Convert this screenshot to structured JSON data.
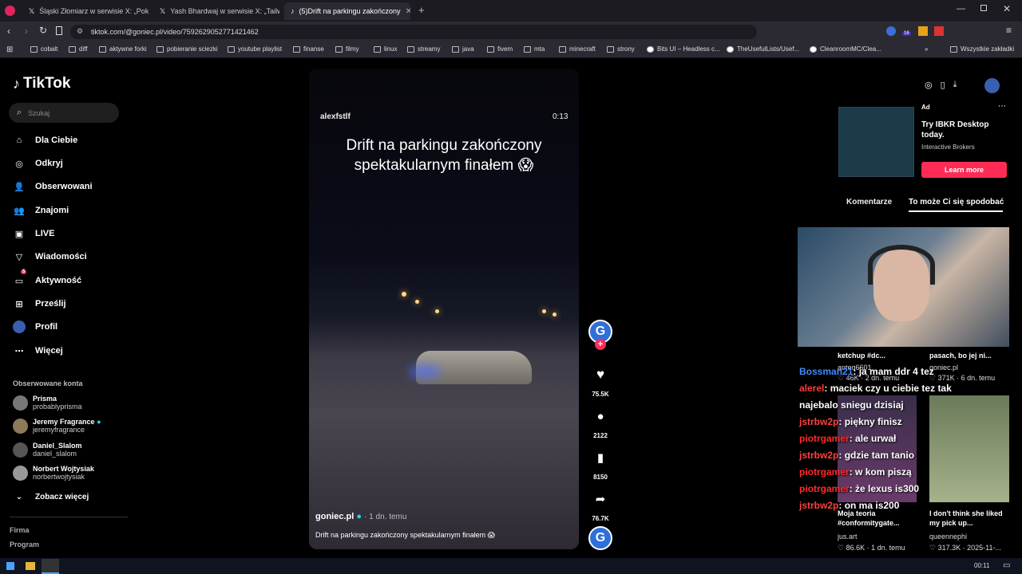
{
  "browser": {
    "tabs": [
      {
        "label": "Śląski Złomiarz w serwisie X: „Pokole"
      },
      {
        "label": "Yash Bhardwaj w serwisie X: „Tailwind"
      },
      {
        "label": "(5)Drift na parkingu zakończony"
      }
    ],
    "url": "tiktok.com/@goniec.pl/video/7592629052771421462",
    "bookmarks": [
      "cobalt",
      "diff",
      "aktywne forki",
      "pobieranie sciezki",
      "youtube playlist",
      "finanse",
      "filmy",
      "linux",
      "streamy",
      "java",
      "fivem",
      "mta",
      "minecraft",
      "strony",
      "Bits UI – Headless c...",
      "TheUsefulLists/Usef...",
      "CleanroomMC/Clea..."
    ],
    "bookmarks_all": "Wszystkie zakładki",
    "ext_badge": "16"
  },
  "sidebar": {
    "logo": "TikTok",
    "search_placeholder": "Szukaj",
    "nav": [
      "Dla Ciebie",
      "Odkryj",
      "Obserwowani",
      "Znajomi",
      "LIVE",
      "Wiadomości",
      "Aktywność",
      "Prześlij",
      "Profil",
      "Więcej"
    ],
    "activity_badge": "5",
    "following_title": "Obserwowane konta",
    "accounts": [
      {
        "name": "Prisma",
        "handle": "probablyprisma"
      },
      {
        "name": "Jeremy Fragrance",
        "handle": "jeremyfragrance"
      },
      {
        "name": "Daniel_Slalom",
        "handle": "daniel_slalom"
      },
      {
        "name": "Norbert Wojtysiak",
        "handle": "norbertwojtysiak"
      }
    ],
    "see_more": "Zobacz więcej",
    "footer": [
      "Firma",
      "Program"
    ]
  },
  "video": {
    "author": "alexfstlf",
    "time": "0:13",
    "overlay_title": "Drift na parkingu zakończony spektakularnym finałem 😱",
    "poster": "goniec.pl",
    "posted": "· 1 dn. temu",
    "caption": "Drift na parkingu zakończony spektakularnym finałem 😱",
    "likes": "75.5K",
    "comments": "2122",
    "saves": "8150",
    "shares": "76.7K"
  },
  "ad": {
    "label": "Ad",
    "title": "Try IBKR Desktop today.",
    "brand": "Interactive Brokers",
    "cta": "Learn more"
  },
  "right_tabs": {
    "comments": "Komentarze",
    "recommended": "To może Ci się spodobać"
  },
  "cards": [
    {
      "title": "ketchup #dc...",
      "user": "anteq6601",
      "likes": "46K",
      "when": "2 dn. temu"
    },
    {
      "title": "pasach, bo jej ni...",
      "user": "goniec.pl",
      "likes": "371K",
      "when": "6 dn. temu"
    },
    {
      "title": "Moja teoria #conformitygate...",
      "user": "jus.art",
      "likes": "86.6K",
      "when": "1 dn. temu"
    },
    {
      "title": "I don't think she liked my pick up...",
      "user": "queennephi",
      "likes": "317.3K",
      "when": "2025-11-..."
    }
  ],
  "chat": [
    {
      "user": "Bossman21",
      "msg": "ja mam ddr 4 tez",
      "color": "#3f8cff"
    },
    {
      "user": "alerel",
      "msg": "maciek czy u ciebie tez tak",
      "color": "#ff3a3a"
    },
    {
      "user": "",
      "msg": "najebalo sniegu dzisiaj",
      "color": "#ffffff"
    },
    {
      "user": "jstrbw2p",
      "msg": "piękny finisz",
      "color": "#ff4040"
    },
    {
      "user": "piotrgamer",
      "msg": "ale urwał",
      "color": "#ff2a2a"
    },
    {
      "user": "jstrbw2p",
      "msg": "gdzie tam tanio",
      "color": "#ff4040"
    },
    {
      "user": "piotrgamer",
      "msg": "w kom piszą",
      "color": "#ff2a2a"
    },
    {
      "user": "piotrgamer",
      "msg": "że lexus is300",
      "color": "#ff2a2a"
    },
    {
      "user": "jstrbw2p",
      "msg": "on ma is200",
      "color": "#ff4040"
    }
  ],
  "taskbar": {
    "time": "00:11"
  },
  "colors": {
    "accent": "#fe2c55",
    "blue": "#2f6fda",
    "verified": "#20d5ec"
  }
}
